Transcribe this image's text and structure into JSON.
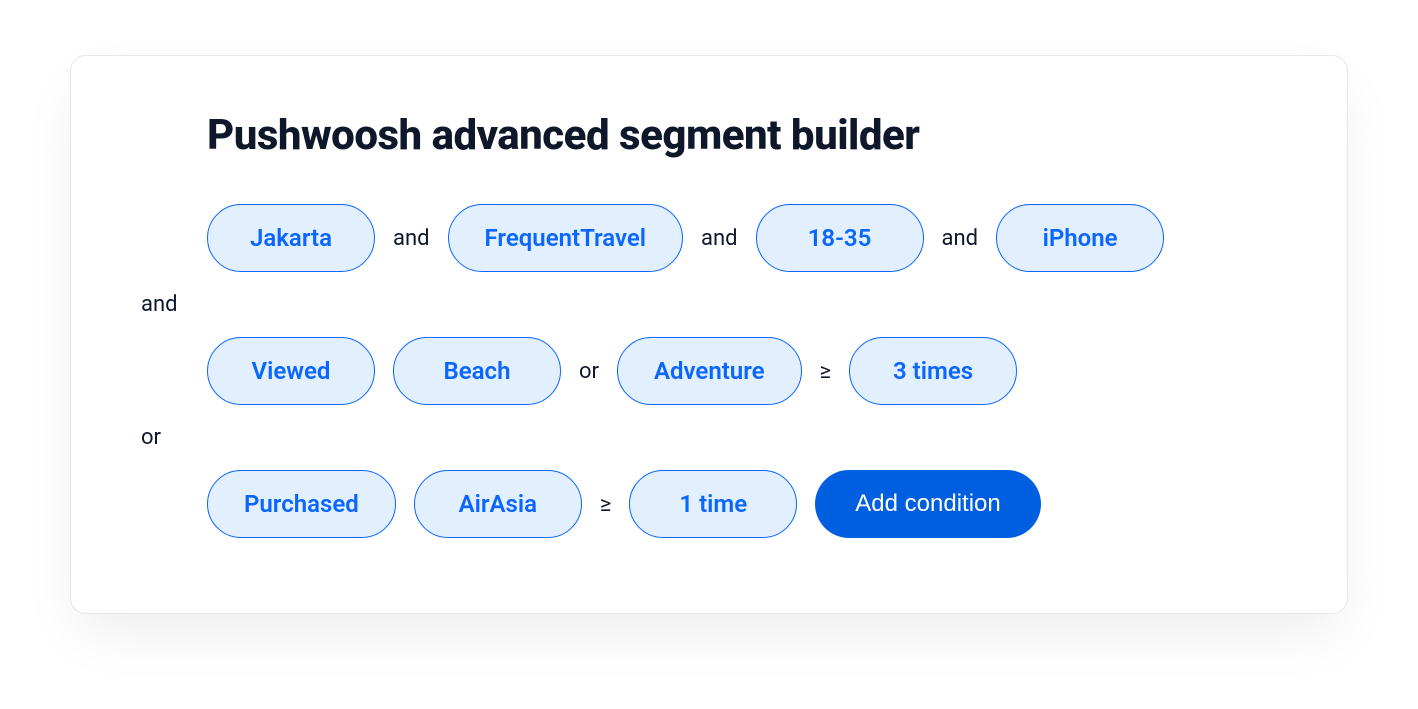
{
  "title": "Pushwoosh advanced segment builder",
  "operators": {
    "and": "and",
    "or": "or",
    "gte": "≥"
  },
  "row1": {
    "pills": [
      "Jakarta",
      "FrequentTravel",
      "18-35",
      "iPhone"
    ]
  },
  "connector1": "and",
  "row2": {
    "pill_viewed": "Viewed",
    "pill_beach": "Beach",
    "op_or": "or",
    "pill_adventure": "Adventure",
    "op_gte": "≥",
    "pill_count": "3 times"
  },
  "connector2": "or",
  "row3": {
    "pill_purchased": "Purchased",
    "pill_airasia": "AirAsia",
    "op_gte": "≥",
    "pill_count": "1 time"
  },
  "add_condition_label": "Add condition",
  "colors": {
    "pill_bg": "#e2efff",
    "pill_border": "#0a66ff",
    "pill_text": "#0a66ff",
    "action_bg": "#005fe0",
    "action_text": "#ffffff"
  }
}
